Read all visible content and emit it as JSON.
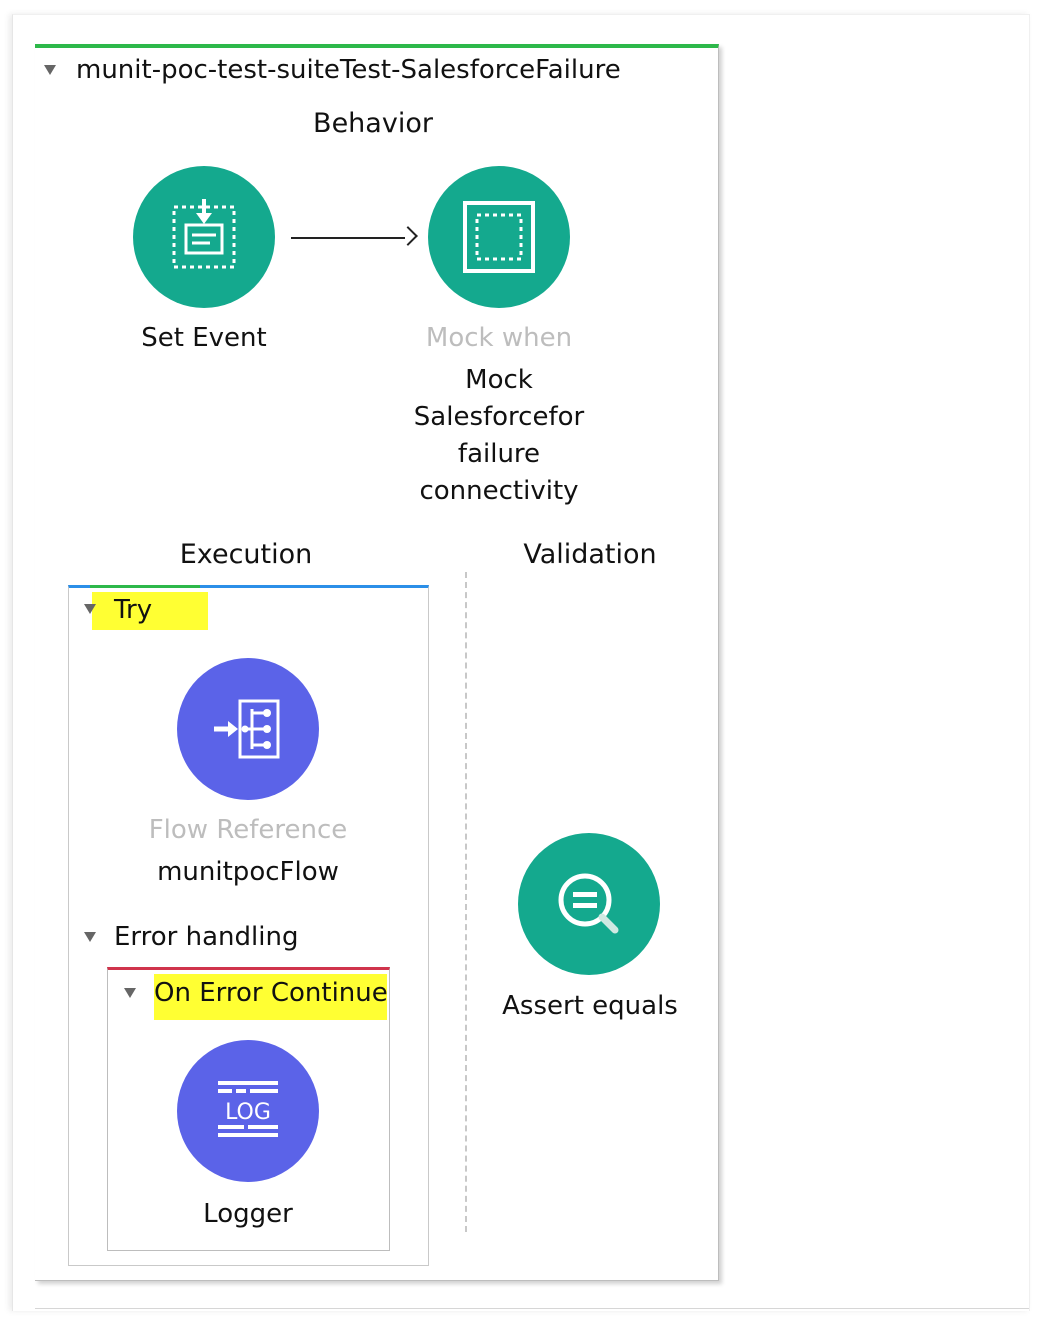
{
  "test": {
    "title": "munit-poc-test-suiteTest-SalesforceFailure",
    "sections": {
      "behavior": "Behavior",
      "execution": "Execution",
      "validation": "Validation"
    }
  },
  "behavior": {
    "set_event": {
      "label": "Set Event",
      "icon": "set-event-icon"
    },
    "mock_when": {
      "type_label": "Mock when",
      "name_lines": [
        "Mock",
        "Salesforcefor",
        "failure",
        "connectivity"
      ],
      "icon": "mock-when-icon"
    }
  },
  "execution": {
    "try": {
      "label": "Try",
      "highlighted": true
    },
    "flow_reference": {
      "type_label": "Flow Reference",
      "name": "munitpocFlow",
      "icon": "flow-reference-icon"
    },
    "error_handling": {
      "label": "Error handling"
    },
    "on_error_continue": {
      "label": "On Error Continue",
      "highlighted": true
    },
    "logger": {
      "label": "Logger",
      "icon_text": "LOG",
      "icon": "logger-icon"
    }
  },
  "validation": {
    "assert_equals": {
      "label": "Assert equals",
      "icon": "assert-equals-icon"
    }
  },
  "colors": {
    "teal": "#14a98e",
    "purple": "#5b63e8",
    "test_border": "#2db84a",
    "try_border": "#2b8fe8",
    "error_border": "#d0344c",
    "highlight": "#ffff33"
  }
}
